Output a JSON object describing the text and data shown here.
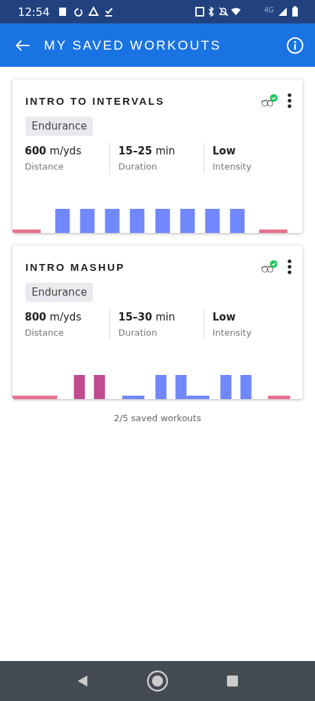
{
  "status_bar": {
    "time": "12:54",
    "network": "4G"
  },
  "app_bar": {
    "title": "MY SAVED WORKOUTS"
  },
  "workouts": [
    {
      "title": "INTRO TO INTERVALS",
      "tag": "Endurance",
      "synced": true,
      "stats": [
        {
          "value": "600",
          "unit": "m/yds",
          "label": "Distance"
        },
        {
          "value": "15–25",
          "unit": "min",
          "label": "Duration"
        },
        {
          "value": "Low",
          "label": "Intensity"
        }
      ]
    },
    {
      "title": "INTRO MASHUP",
      "tag": "Endurance",
      "synced": true,
      "stats": [
        {
          "value": "800",
          "unit": "m/yds",
          "label": "Distance"
        },
        {
          "value": "15–30",
          "unit": "min",
          "label": "Duration"
        },
        {
          "value": "Low",
          "label": "Intensity"
        }
      ]
    }
  ],
  "footer": "2/5 saved workouts"
}
